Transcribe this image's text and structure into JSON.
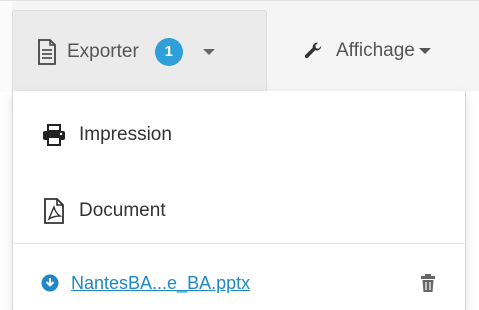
{
  "toolbar": {
    "export_label": "Exporter",
    "export_badge": "1",
    "display_label": "Affichage"
  },
  "menu": {
    "items": [
      {
        "label": "Impression",
        "icon": "printer-icon"
      },
      {
        "label": "Document",
        "icon": "pdf-icon"
      }
    ],
    "file": {
      "name": "NantesBA...e_BA.pptx",
      "icon": "download-circle-icon",
      "delete_icon": "trash-icon"
    }
  },
  "colors": {
    "accent": "#2e9fd8",
    "link": "#1e88c8"
  }
}
